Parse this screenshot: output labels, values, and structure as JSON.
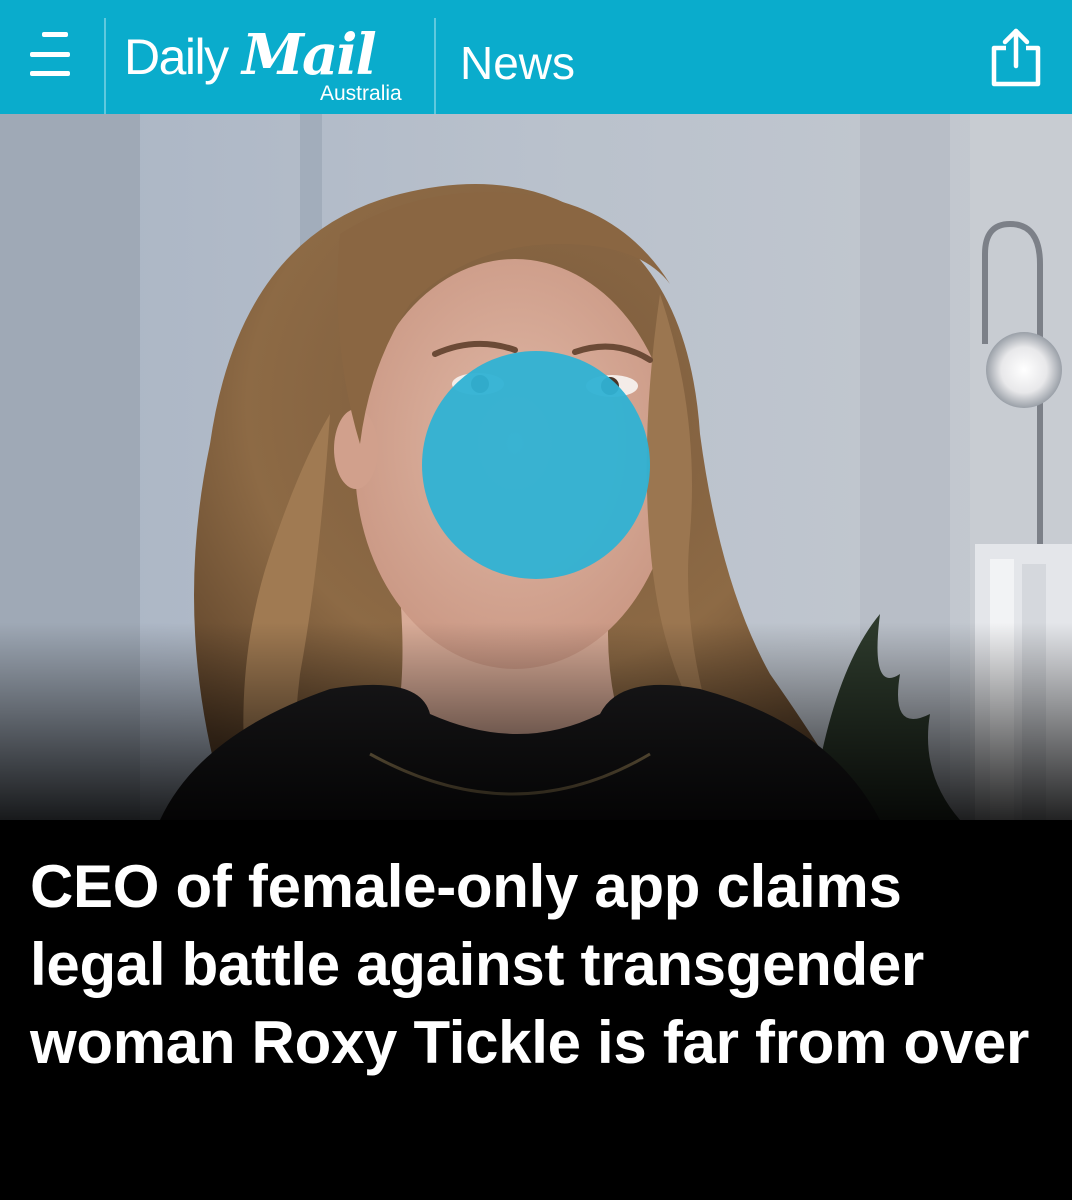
{
  "header": {
    "brand_daily": "Daily",
    "brand_mail": "Mail",
    "brand_region": "Australia",
    "section": "News",
    "menu_icon": "hamburger-menu-icon",
    "share_icon": "share-icon"
  },
  "article": {
    "image_alt": "Woman speaking on video call with face obscured by blue circle",
    "headline": "CEO of female-only app claims legal battle against transgender woman Roxy Tickle is far from over"
  },
  "colors": {
    "brand_bar": "#0aaccc",
    "face_cover": "#2fb2d4",
    "headline_bg": "#000000",
    "headline_text": "#ffffff"
  }
}
